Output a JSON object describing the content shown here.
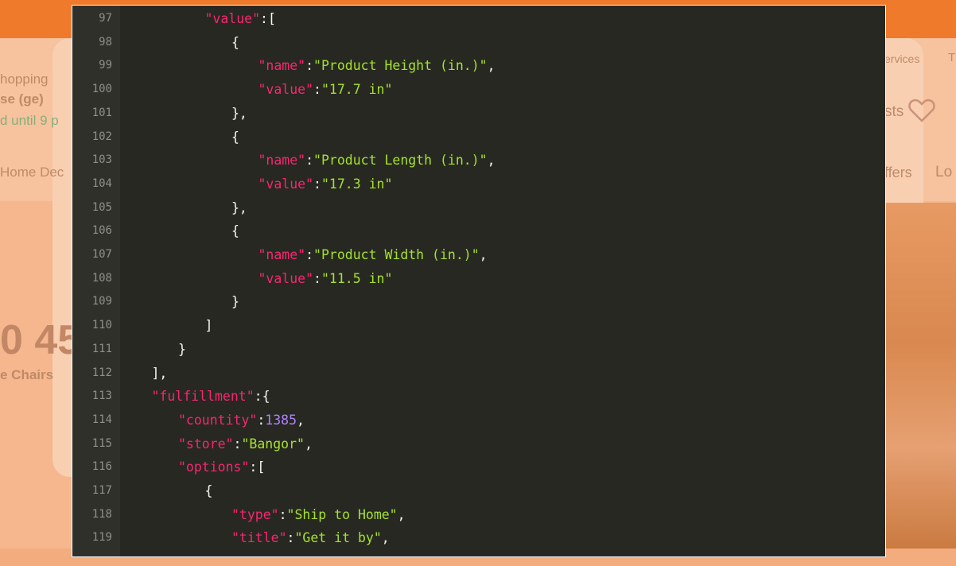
{
  "background_page": {
    "left_texts": [
      "hopping",
      "se (ge)",
      "d until 9 p",
      "Home Dec",
      "0 45",
      "e Chairs"
    ],
    "right_texts": [
      "ervices",
      "T",
      "sts",
      "ffers",
      "Lo"
    ]
  },
  "editor": {
    "lines": [
      {
        "num": "97",
        "indent": 3,
        "tokens": [
          {
            "t": "key",
            "v": "\"value\""
          },
          {
            "t": "pun",
            "v": ":["
          }
        ]
      },
      {
        "num": "98",
        "indent": 4,
        "tokens": [
          {
            "t": "pun",
            "v": "{"
          }
        ]
      },
      {
        "num": "99",
        "indent": 5,
        "tokens": [
          {
            "t": "key",
            "v": "\"name\""
          },
          {
            "t": "pun",
            "v": ":"
          },
          {
            "t": "strv",
            "v": "\"Product Height (in.)\""
          },
          {
            "t": "pun",
            "v": ","
          }
        ]
      },
      {
        "num": "100",
        "indent": 5,
        "tokens": [
          {
            "t": "key",
            "v": "\"value\""
          },
          {
            "t": "pun",
            "v": ":"
          },
          {
            "t": "strv",
            "v": "\"17.7 in\""
          }
        ]
      },
      {
        "num": "101",
        "indent": 4,
        "tokens": [
          {
            "t": "pun",
            "v": "},"
          }
        ]
      },
      {
        "num": "102",
        "indent": 4,
        "tokens": [
          {
            "t": "pun",
            "v": "{"
          }
        ]
      },
      {
        "num": "103",
        "indent": 5,
        "tokens": [
          {
            "t": "key",
            "v": "\"name\""
          },
          {
            "t": "pun",
            "v": ":"
          },
          {
            "t": "strv",
            "v": "\"Product Length (in.)\""
          },
          {
            "t": "pun",
            "v": ","
          }
        ]
      },
      {
        "num": "104",
        "indent": 5,
        "tokens": [
          {
            "t": "key",
            "v": "\"value\""
          },
          {
            "t": "pun",
            "v": ":"
          },
          {
            "t": "strv",
            "v": "\"17.3 in\""
          }
        ]
      },
      {
        "num": "105",
        "indent": 4,
        "tokens": [
          {
            "t": "pun",
            "v": "},"
          }
        ]
      },
      {
        "num": "106",
        "indent": 4,
        "tokens": [
          {
            "t": "pun",
            "v": "{"
          }
        ]
      },
      {
        "num": "107",
        "indent": 5,
        "tokens": [
          {
            "t": "key",
            "v": "\"name\""
          },
          {
            "t": "pun",
            "v": ":"
          },
          {
            "t": "strv",
            "v": "\"Product Width (in.)\""
          },
          {
            "t": "pun",
            "v": ","
          }
        ]
      },
      {
        "num": "108",
        "indent": 5,
        "tokens": [
          {
            "t": "key",
            "v": "\"value\""
          },
          {
            "t": "pun",
            "v": ":"
          },
          {
            "t": "strv",
            "v": "\"11.5 in\""
          }
        ]
      },
      {
        "num": "109",
        "indent": 4,
        "tokens": [
          {
            "t": "pun",
            "v": "}"
          }
        ]
      },
      {
        "num": "110",
        "indent": 3,
        "tokens": [
          {
            "t": "pun",
            "v": "]"
          }
        ]
      },
      {
        "num": "111",
        "indent": 2,
        "tokens": [
          {
            "t": "pun",
            "v": "}"
          }
        ]
      },
      {
        "num": "112",
        "indent": 1,
        "tokens": [
          {
            "t": "pun",
            "v": "],"
          }
        ]
      },
      {
        "num": "113",
        "indent": 1,
        "tokens": [
          {
            "t": "key",
            "v": "\"fulfillment\""
          },
          {
            "t": "pun",
            "v": ":{"
          }
        ]
      },
      {
        "num": "114",
        "indent": 2,
        "tokens": [
          {
            "t": "key",
            "v": "\"countity\""
          },
          {
            "t": "pun",
            "v": ":"
          },
          {
            "t": "num",
            "v": "1385"
          },
          {
            "t": "pun",
            "v": ","
          }
        ]
      },
      {
        "num": "115",
        "indent": 2,
        "tokens": [
          {
            "t": "key",
            "v": "\"store\""
          },
          {
            "t": "pun",
            "v": ":"
          },
          {
            "t": "strv",
            "v": "\"Bangor\""
          },
          {
            "t": "pun",
            "v": ","
          }
        ]
      },
      {
        "num": "116",
        "indent": 2,
        "tokens": [
          {
            "t": "key",
            "v": "\"options\""
          },
          {
            "t": "pun",
            "v": ":["
          }
        ]
      },
      {
        "num": "117",
        "indent": 3,
        "tokens": [
          {
            "t": "pun",
            "v": "{"
          }
        ]
      },
      {
        "num": "118",
        "indent": 4,
        "tokens": [
          {
            "t": "key",
            "v": "\"type\""
          },
          {
            "t": "pun",
            "v": ":"
          },
          {
            "t": "strv",
            "v": "\"Ship to Home\""
          },
          {
            "t": "pun",
            "v": ","
          }
        ]
      },
      {
        "num": "119",
        "indent": 4,
        "tokens": [
          {
            "t": "key",
            "v": "\"title\""
          },
          {
            "t": "pun",
            "v": ":"
          },
          {
            "t": "strv",
            "v": "\"Get it by\""
          },
          {
            "t": "pun",
            "v": ","
          }
        ]
      }
    ],
    "colors": {
      "background": "#272822",
      "key": "#f92672",
      "string": "#a6e22e",
      "number": "#ae81ff",
      "punctuation": "#f8f8f2",
      "line_number": "#8f908a"
    }
  }
}
